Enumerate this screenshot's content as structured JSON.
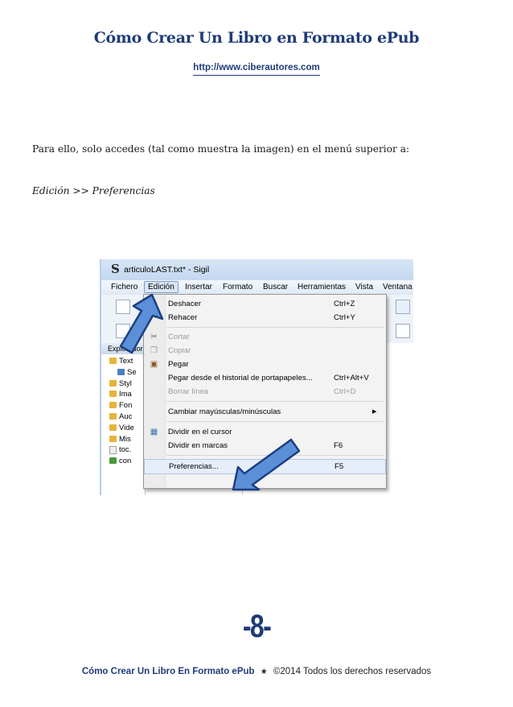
{
  "header": {
    "title": "Cómo Crear Un Libro en Formato ePub",
    "url": "http://www.ciberautores.com"
  },
  "body": {
    "paragraph1": "Para ello, solo accedes (tal como muestra la imagen) en el menú superior a:",
    "paragraph2": "Edición >> Preferencias"
  },
  "screenshot": {
    "app_icon": "S",
    "window_title": "articuloLAST.txt* - Sigil",
    "menubar": [
      "Fichero",
      "Edición",
      "Insertar",
      "Formato",
      "Buscar",
      "Herramientas",
      "Vista",
      "Ventana"
    ],
    "panel_title": "Explorador",
    "tree": [
      "Text",
      "Se",
      "Styl",
      "Ima",
      "Fon",
      "Auc",
      "Vide",
      "Mis",
      "toc.",
      "con"
    ],
    "menu": [
      {
        "label": "Deshacer",
        "shortcut": "Ctrl+Z"
      },
      {
        "label": "Rehacer",
        "shortcut": "Ctrl+Y"
      },
      {
        "label": "Cortar",
        "shortcut": ""
      },
      {
        "label": "Copiar",
        "shortcut": ""
      },
      {
        "label": "Pegar",
        "shortcut": ""
      },
      {
        "label": "Pegar desde el historial de portapapeles...",
        "shortcut": "Ctrl+Alt+V"
      },
      {
        "label": "Borrar línea",
        "shortcut": "Ctrl+D"
      },
      {
        "label": "Cambiar mayúsculas/minúsculas",
        "shortcut": ""
      },
      {
        "label": "Dividir en el cursor",
        "shortcut": ""
      },
      {
        "label": "Dividir en marcas",
        "shortcut": "F6"
      },
      {
        "label": "Preferencias...",
        "shortcut": "F5"
      }
    ],
    "arrow_color": "#5b8fd8"
  },
  "page_number": "-8-",
  "footer": {
    "title": "Cómo Crear Un Libro En Formato ePub",
    "symbol": "★",
    "copyright": "©2014 Todos los derechos reservados"
  },
  "colors": {
    "accent": "#1f3b78"
  }
}
